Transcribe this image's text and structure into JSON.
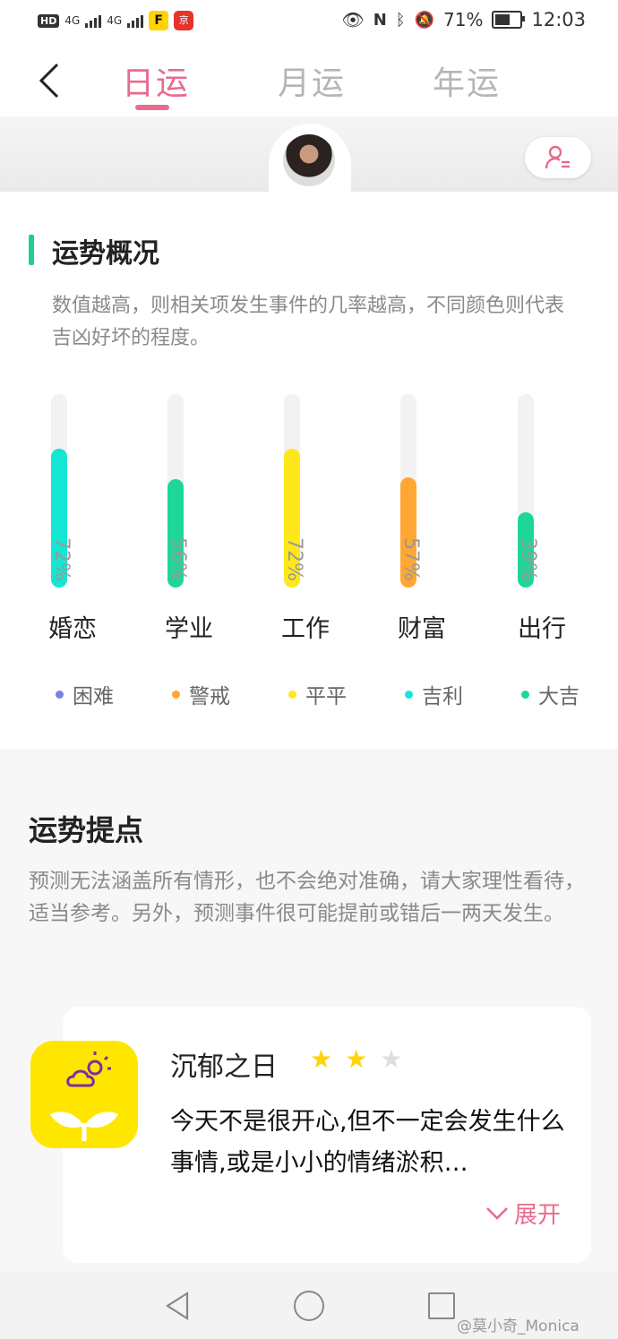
{
  "status_bar": {
    "hd": "HD",
    "network1": "4G",
    "network2": "4G",
    "app1_glyph": "F",
    "app2_glyph": "京",
    "battery_text": "71%",
    "battery_level": 0.71,
    "time": "12:03"
  },
  "header": {
    "tabs": [
      {
        "label": "日运",
        "active": true
      },
      {
        "label": "月运",
        "active": false
      },
      {
        "label": "年运",
        "active": false
      }
    ],
    "accent_color": "#e86b8e"
  },
  "overview": {
    "title": "运势概况",
    "description": "数值越高，则相关项发生事件的几率越高，不同颜色则代表吉凶好坏的程度。",
    "bars": [
      {
        "label": "婚恋",
        "value": 72,
        "pct_text": "72%",
        "color": "#14e6d4"
      },
      {
        "label": "学业",
        "value": 56,
        "pct_text": "56%",
        "color": "#1fd69a"
      },
      {
        "label": "工作",
        "value": 72,
        "pct_text": "72%",
        "color": "#ffe81a"
      },
      {
        "label": "财富",
        "value": 57,
        "pct_text": "57%",
        "color": "#ffa733"
      },
      {
        "label": "出行",
        "value": 39,
        "pct_text": "39%",
        "color": "#1fd69a"
      }
    ],
    "legend": [
      {
        "label": "困难",
        "color": "#7b7fe0"
      },
      {
        "label": "警戒",
        "color": "#ffa733"
      },
      {
        "label": "平平",
        "color": "#ffe81a"
      },
      {
        "label": "吉利",
        "color": "#14e6d4"
      },
      {
        "label": "大吉",
        "color": "#1fd69a"
      }
    ]
  },
  "tips": {
    "title": "运势提点",
    "description": "预测无法涵盖所有情形，也不会绝对准确，请大家理性看待，适当参考。另外，预测事件很可能提前或错后一两天发生。",
    "card": {
      "title": "沉郁之日",
      "stars_filled": 2,
      "stars_total": 3,
      "text": "今天不是很开心,但不一定会发生什么事情,或是小小的情绪淤积…",
      "expand_label": "展开",
      "icon": "cloud-sun-sprout-icon"
    }
  },
  "watermark": "@莫小奇_Monica"
}
